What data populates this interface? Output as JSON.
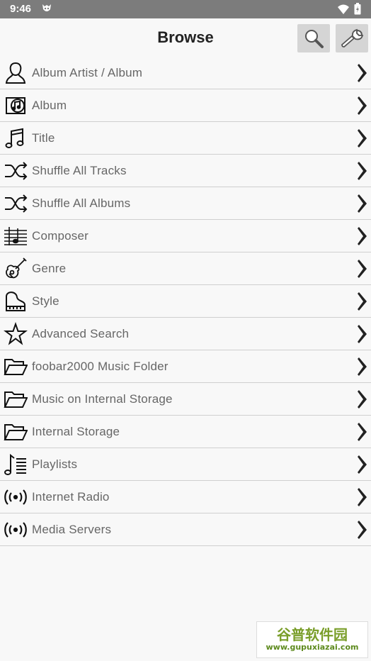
{
  "status_bar": {
    "time": "9:46"
  },
  "header": {
    "title": "Browse",
    "search_icon": "search-icon",
    "settings_icon": "wrench-icon"
  },
  "items": [
    {
      "label": "Album Artist / Album",
      "icon": "person-icon"
    },
    {
      "label": "Album",
      "icon": "album-icon"
    },
    {
      "label": "Title",
      "icon": "music-note-icon"
    },
    {
      "label": "Shuffle All Tracks",
      "icon": "shuffle-icon"
    },
    {
      "label": "Shuffle All Albums",
      "icon": "shuffle-icon"
    },
    {
      "label": "Composer",
      "icon": "staff-icon"
    },
    {
      "label": "Genre",
      "icon": "guitar-icon"
    },
    {
      "label": "Style",
      "icon": "piano-icon"
    },
    {
      "label": "Advanced Search",
      "icon": "star-icon"
    },
    {
      "label": "foobar2000 Music Folder",
      "icon": "folder-icon"
    },
    {
      "label": "Music on Internal Storage",
      "icon": "folder-icon"
    },
    {
      "label": "Internal Storage",
      "icon": "folder-icon"
    },
    {
      "label": "Playlists",
      "icon": "playlist-icon"
    },
    {
      "label": "Internet Radio",
      "icon": "radio-icon"
    },
    {
      "label": "Media Servers",
      "icon": "radio-icon"
    }
  ],
  "watermark": {
    "title": "谷普软件园",
    "url": "www.gupuxiazai.com"
  }
}
